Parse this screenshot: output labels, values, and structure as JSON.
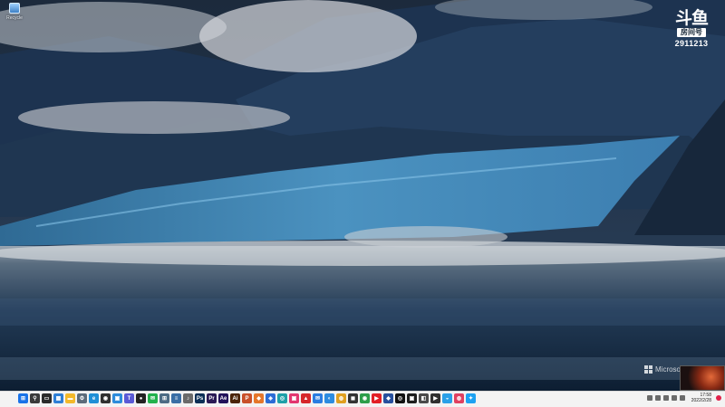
{
  "desktop": {
    "icons": [
      {
        "label": "Recycle",
        "icon": "recycle-bin-icon"
      }
    ]
  },
  "watermark": {
    "logo": "斗鱼",
    "room_label": "房间号",
    "room_number": "2911213"
  },
  "brand": {
    "text": "Microsoft"
  },
  "taskbar": {
    "apps": [
      {
        "name": "start-button",
        "color": "#1a73e8",
        "glyph": "⊞"
      },
      {
        "name": "search-icon",
        "color": "#3a3a3a",
        "glyph": "⚲"
      },
      {
        "name": "task-view-icon",
        "color": "#2b2b2b",
        "glyph": "▭"
      },
      {
        "name": "widgets-icon",
        "color": "#2f7fd6",
        "glyph": "▦"
      },
      {
        "name": "file-explorer-icon",
        "color": "#f3b92a",
        "glyph": "▬"
      },
      {
        "name": "settings-icon",
        "color": "#5c6b7a",
        "glyph": "⚙"
      },
      {
        "name": "edge-icon",
        "color": "#1f8fd6",
        "glyph": "e"
      },
      {
        "name": "maps-icon",
        "color": "#303030",
        "glyph": "◉"
      },
      {
        "name": "photos-icon",
        "color": "#2d8cdb",
        "glyph": "▣"
      },
      {
        "name": "teams-icon",
        "color": "#5a5ad6",
        "glyph": "T"
      },
      {
        "name": "penguin-icon",
        "color": "#222222",
        "glyph": "●"
      },
      {
        "name": "wechat-icon",
        "color": "#22b14c",
        "glyph": "✉"
      },
      {
        "name": "calculator-icon",
        "color": "#4d6b84",
        "glyph": "⊞"
      },
      {
        "name": "notepad-icon",
        "color": "#3a6ea5",
        "glyph": "≡"
      },
      {
        "name": "mic-icon",
        "color": "#6a6a6a",
        "glyph": "♪"
      },
      {
        "name": "photoshop-icon",
        "color": "#0b2f56",
        "glyph": "Ps"
      },
      {
        "name": "premiere-icon",
        "color": "#2a1a55",
        "glyph": "Pr"
      },
      {
        "name": "after-effects-icon",
        "color": "#22125a",
        "glyph": "Ae"
      },
      {
        "name": "illustrator-icon",
        "color": "#4a2308",
        "glyph": "Ai"
      },
      {
        "name": "powerpoint-icon",
        "color": "#c8502a",
        "glyph": "P"
      },
      {
        "name": "app-orange-icon",
        "color": "#e5762a",
        "glyph": "◆"
      },
      {
        "name": "app-blue-icon",
        "color": "#2b6cd6",
        "glyph": "◈"
      },
      {
        "name": "app-teal-icon",
        "color": "#1ea0a8",
        "glyph": "◎"
      },
      {
        "name": "app-pink-icon",
        "color": "#e2366f",
        "glyph": "▣"
      },
      {
        "name": "app-red-icon",
        "color": "#d6272b",
        "glyph": "▲"
      },
      {
        "name": "mail-icon",
        "color": "#2a7de1",
        "glyph": "✉"
      },
      {
        "name": "browser-icon",
        "color": "#2c8ce0",
        "glyph": "◐"
      },
      {
        "name": "chrome-icon",
        "color": "#e0a020",
        "glyph": "◍"
      },
      {
        "name": "app-dark-icon",
        "color": "#333333",
        "glyph": "◼"
      },
      {
        "name": "app-green-icon",
        "color": "#2d9e4a",
        "glyph": "◉"
      },
      {
        "name": "youtube-icon",
        "color": "#e21f26",
        "glyph": "▶"
      },
      {
        "name": "app-shield-icon",
        "color": "#27509e",
        "glyph": "◆"
      },
      {
        "name": "media-icon",
        "color": "#111111",
        "glyph": "◎"
      },
      {
        "name": "app-black-icon",
        "color": "#1d1d1d",
        "glyph": "▣"
      },
      {
        "name": "app-grey-icon",
        "color": "#4a4a4a",
        "glyph": "◧"
      },
      {
        "name": "player-icon",
        "color": "#303030",
        "glyph": "▶"
      },
      {
        "name": "app-sky-icon",
        "color": "#2aa0e8",
        "glyph": "◒"
      },
      {
        "name": "app-rose-icon",
        "color": "#e04060",
        "glyph": "◍"
      },
      {
        "name": "twitter-icon",
        "color": "#1da1f2",
        "glyph": "✦"
      }
    ],
    "tray_icons": [
      "chevron-up-icon",
      "network-icon",
      "volume-icon",
      "battery-icon",
      "ime-icon"
    ],
    "time": "17:58",
    "date": "2022/2/28"
  }
}
